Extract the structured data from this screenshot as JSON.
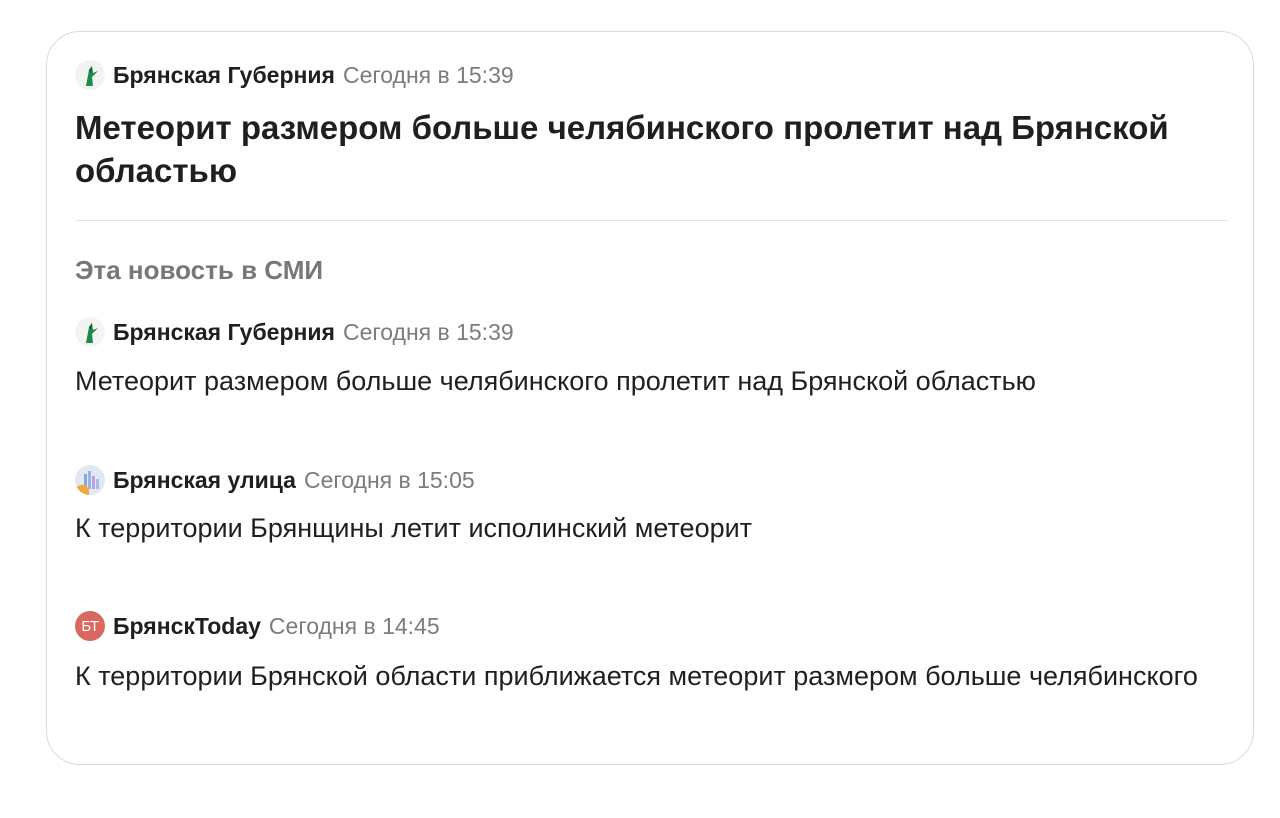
{
  "main_story": {
    "source": "Брянская Губерния",
    "time": "Сегодня в 15:39",
    "logo_icon": "brand-logo-icon",
    "headline": "Метеорит размером больше челябинского пролетит над Брянской областью"
  },
  "media_section": {
    "title": "Эта новость в СМИ",
    "items": [
      {
        "source": "Брянская Губерния",
        "time": "Сегодня в 15:39",
        "logo_icon": "brand-logo-icon",
        "text": "Метеорит размером больше челябинского пролетит над Брянской областью"
      },
      {
        "source": "Брянская улица",
        "time": "Сегодня в 15:05",
        "logo_icon": "city-logo-icon",
        "text": "К территории Брянщины летит исполинский метеорит"
      },
      {
        "source": "БрянскToday",
        "time": "Сегодня в 14:45",
        "logo_text": "БТ",
        "text": "К территории Брянской области приближается метеорит размером больше челябинского"
      }
    ]
  },
  "colors": {
    "text": "#1f1f23",
    "muted": "#7b7b80",
    "border": "#d9d9de",
    "bt_logo": "#d9695f",
    "gub_logo": "#1b8a4a"
  }
}
